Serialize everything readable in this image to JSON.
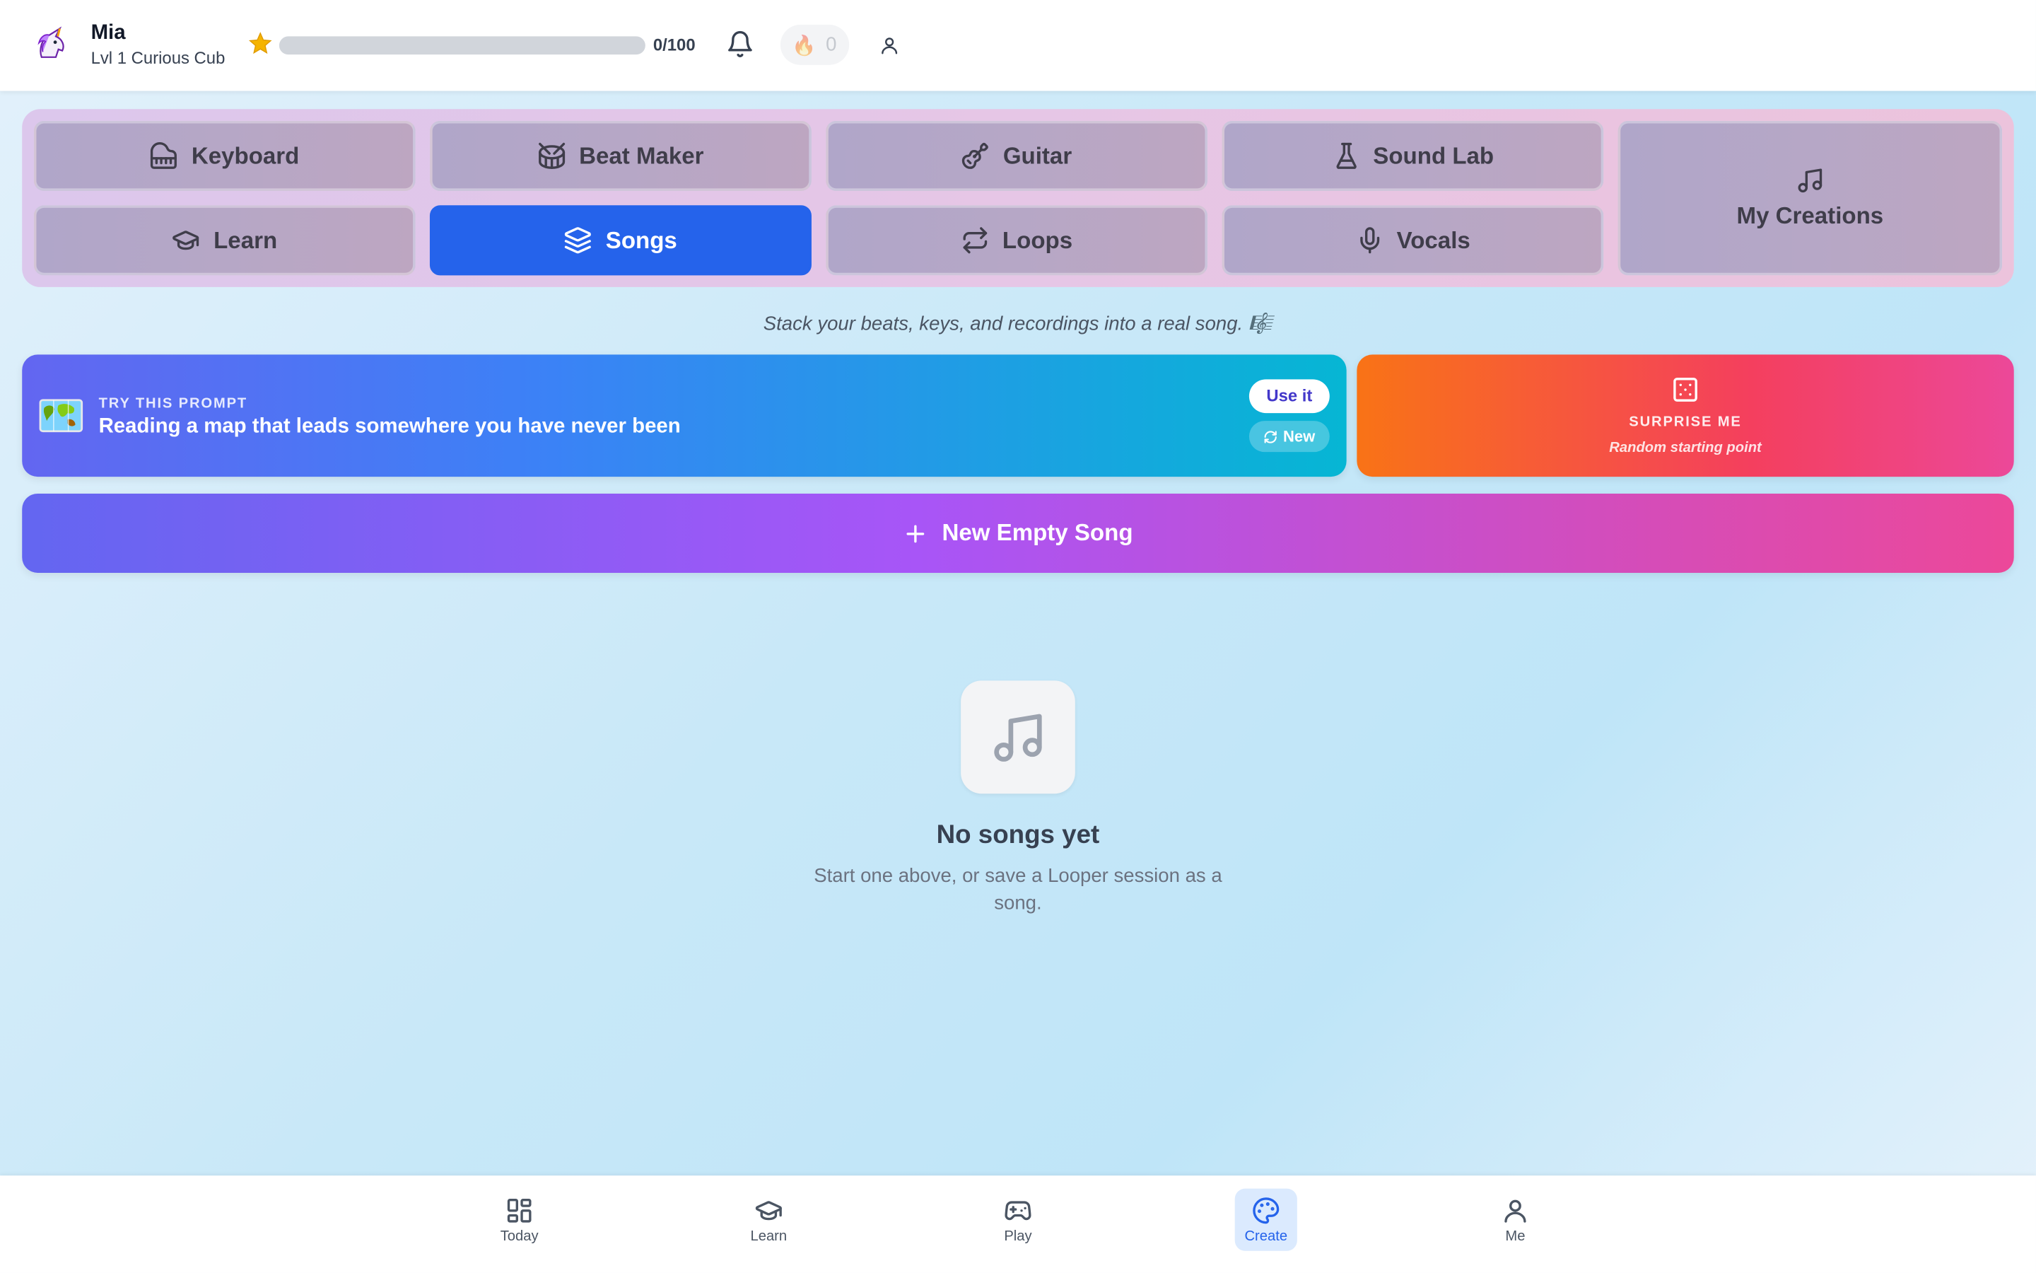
{
  "header": {
    "user_name": "Mia",
    "user_level": "Lvl 1 Curious Cub",
    "avatar_icon": "unicorn-icon",
    "xp_text": "0/100",
    "xp_progress": 0,
    "streak_count": "0",
    "streak_icon": "flame-icon"
  },
  "tools": {
    "keyboard": "Keyboard",
    "beat_maker": "Beat Maker",
    "guitar": "Guitar",
    "sound_lab": "Sound Lab",
    "my_creations": "My Creations",
    "learn": "Learn",
    "songs": "Songs",
    "loops": "Loops",
    "vocals": "Vocals",
    "active": "Songs",
    "active_color": "#2563eb"
  },
  "tagline": "Stack your beats, keys, and recordings into a real song. 🎼",
  "prompt": {
    "kicker": "TRY THIS PROMPT",
    "text": "Reading a map that leads somewhere you have never been",
    "use_label": "Use it",
    "new_label": "New",
    "icon": "world-map-icon"
  },
  "surprise": {
    "title": "SURPRISE ME",
    "subtitle": "Random starting point",
    "icon": "dice-icon"
  },
  "new_song": {
    "label": "New Empty Song"
  },
  "empty_state": {
    "title": "No songs yet",
    "description": "Start one above, or save a Looper session as a song.",
    "icon": "music-note-icon"
  },
  "bottom_nav": {
    "today": "Today",
    "learn": "Learn",
    "play": "Play",
    "create": "Create",
    "me": "Me",
    "active": "Create"
  }
}
